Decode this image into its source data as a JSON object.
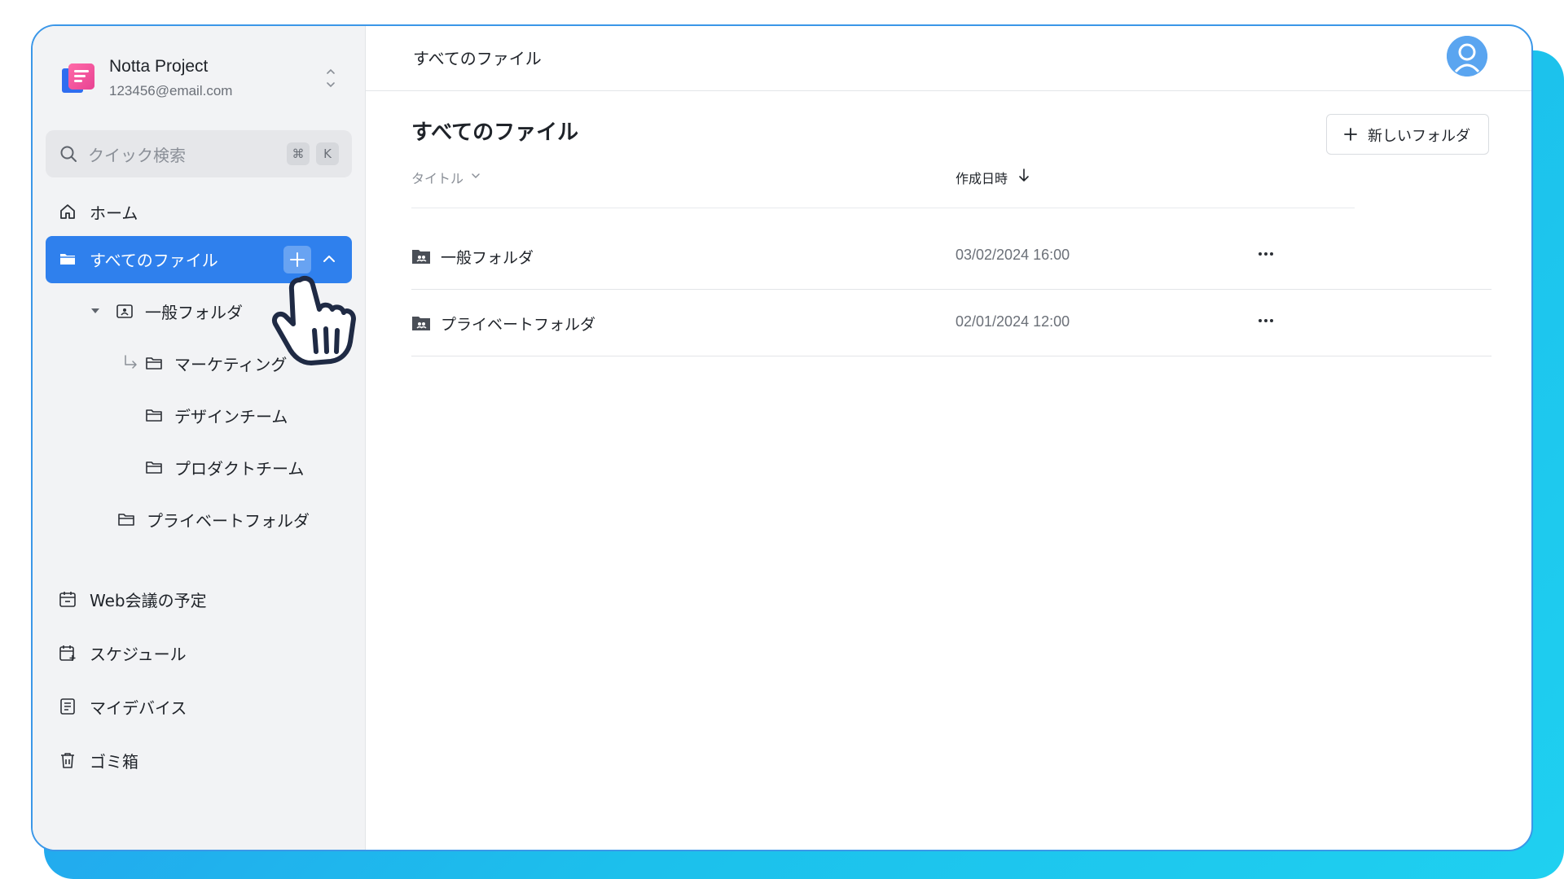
{
  "account": {
    "name": "Notta Project",
    "email": "123456@email.com"
  },
  "search": {
    "placeholder": "クイック検索",
    "shortcut_key1": "⌘",
    "shortcut_key2": "K"
  },
  "sidebar": {
    "home": "ホーム",
    "all_files": "すべてのファイル",
    "tree": {
      "general_folder": "一般フォルダ",
      "marketing": "マーケティング",
      "design_team": "デザインチーム",
      "product_team": "プロダクトチーム",
      "private_folder": "プライベートフォルダ"
    },
    "meetings": "Web会議の予定",
    "schedule": "スケジュール",
    "my_devices": "マイデバイス",
    "trash": "ゴミ箱"
  },
  "header": {
    "title": "すべてのファイル"
  },
  "main": {
    "page_title": "すべてのファイル",
    "new_folder_label": "新しいフォルダ",
    "columns": {
      "title": "タイトル",
      "created": "作成日時"
    },
    "rows": [
      {
        "name": "一般フォルダ",
        "date": "03/02/2024 16:00"
      },
      {
        "name": "プライベートフォルダ",
        "date": "02/01/2024 12:00"
      }
    ]
  },
  "colors": {
    "accent": "#2f80ed",
    "sidebar_bg": "#f2f3f5",
    "backdrop": "#1cc0ec"
  }
}
